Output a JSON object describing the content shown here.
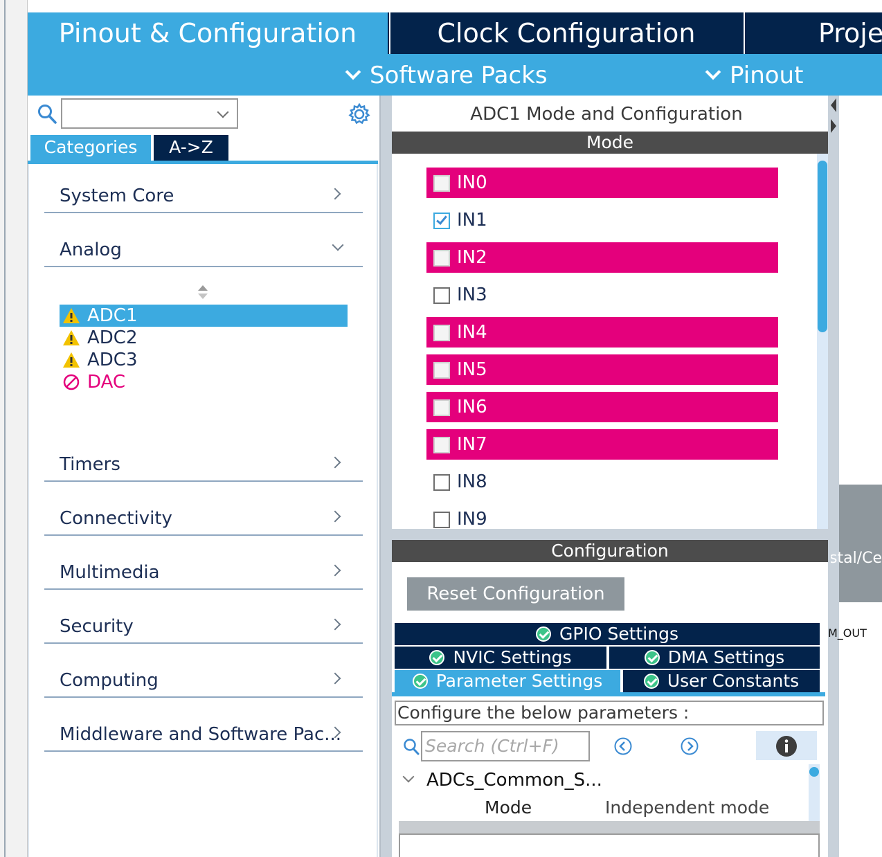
{
  "tabs": {
    "pinout": "Pinout & Configuration",
    "clock": "Clock Configuration",
    "project": "Proje"
  },
  "sub_menu": {
    "software_packs": "Software Packs",
    "pinout": "Pinout"
  },
  "left_panel": {
    "search_value": "",
    "tab_categories": "Categories",
    "tab_az": "A->Z",
    "categories": [
      "System Core",
      "Analog",
      "Timers",
      "Connectivity",
      "Multimedia",
      "Security",
      "Computing",
      "Middleware and Software Pac..."
    ],
    "analog_items": [
      {
        "label": "ADC1",
        "status": "warning",
        "selected": true
      },
      {
        "label": "ADC2",
        "status": "warning",
        "selected": false
      },
      {
        "label": "ADC3",
        "status": "warning",
        "selected": false
      },
      {
        "label": "DAC",
        "status": "disabled",
        "selected": false
      }
    ]
  },
  "center": {
    "title": "ADC1 Mode and Configuration",
    "mode_header": "Mode",
    "channels": [
      {
        "label": "IN0",
        "checked": false,
        "conflict": true
      },
      {
        "label": "IN1",
        "checked": true,
        "conflict": false
      },
      {
        "label": "IN2",
        "checked": false,
        "conflict": true
      },
      {
        "label": "IN3",
        "checked": false,
        "conflict": false
      },
      {
        "label": "IN4",
        "checked": false,
        "conflict": true
      },
      {
        "label": "IN5",
        "checked": false,
        "conflict": true
      },
      {
        "label": "IN6",
        "checked": false,
        "conflict": true
      },
      {
        "label": "IN7",
        "checked": false,
        "conflict": true
      },
      {
        "label": "IN8",
        "checked": false,
        "conflict": false
      },
      {
        "label": "IN9",
        "checked": false,
        "conflict": false
      }
    ],
    "config_header": "Configuration",
    "reset_button": "Reset Configuration",
    "settings_tabs": {
      "gpio": "GPIO Settings",
      "nvic": "NVIC Settings",
      "dma": "DMA Settings",
      "parameter": "Parameter Settings",
      "user_constants": "User Constants"
    },
    "params_caption": "Configure the below parameters :",
    "search_placeholder": "Search (Ctrl+F)",
    "tree_group": "ADCs_Common_S...",
    "param_name": "Mode",
    "param_value": "Independent mode"
  },
  "right": {
    "pin_label": "stal/Ce",
    "pin_label_2": "M_OUT"
  },
  "colors": {
    "accent": "#3caae0",
    "navy": "#03234b",
    "conflict": "#e4007c",
    "header_gray": "#4c4c4c"
  }
}
